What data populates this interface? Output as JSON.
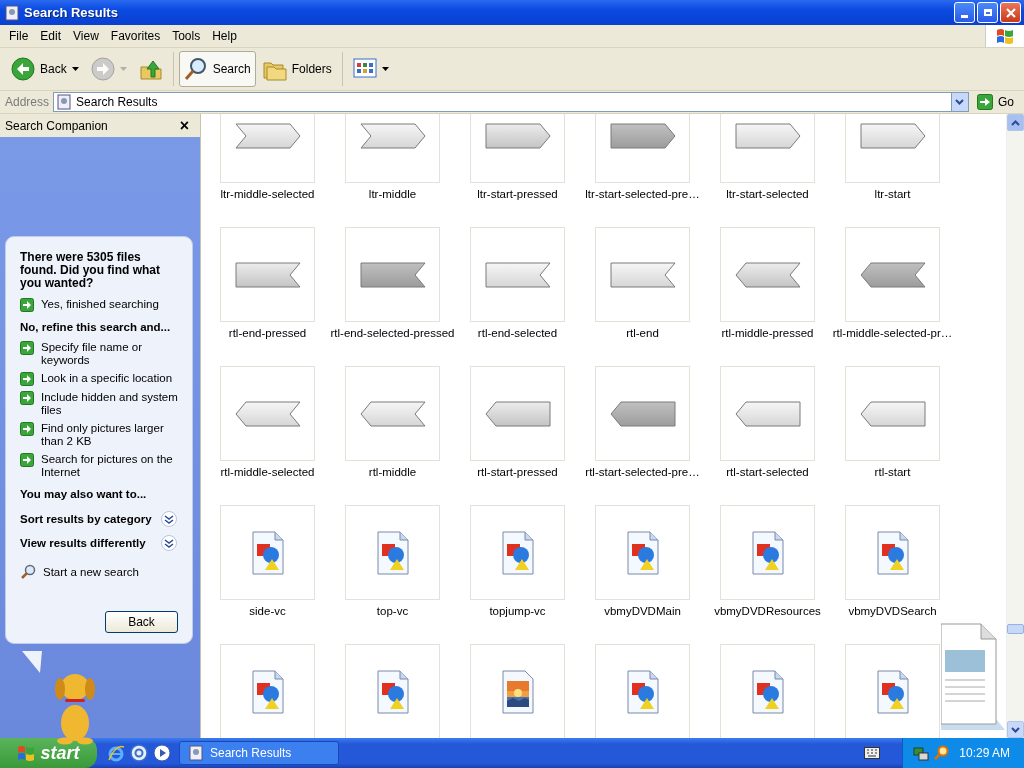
{
  "window": {
    "title": "Search Results"
  },
  "menu": [
    "File",
    "Edit",
    "View",
    "Favorites",
    "Tools",
    "Help"
  ],
  "toolbar": [
    {
      "kind": "back",
      "label": "Back",
      "disabled": false
    },
    {
      "kind": "forward",
      "disabled": true
    },
    {
      "kind": "up"
    },
    {
      "kind": "search",
      "label": "Search",
      "selected": true
    },
    {
      "kind": "folders",
      "label": "Folders",
      "selected": false
    },
    {
      "kind": "views"
    }
  ],
  "address": {
    "label": "Address",
    "value": "Search Results",
    "go": "Go"
  },
  "companion": {
    "title": "Search Companion",
    "close": "×",
    "message": "There were 5305 files found. Did you find what you wanted?",
    "done_links": [
      "Yes, finished searching"
    ],
    "refine_heading": "No, refine this search and...",
    "refine_links": [
      "Specify file name or keywords",
      "Look in a specific location",
      "Include hidden and system files",
      "Find only pictures larger than 2 KB",
      "Search for pictures on the Internet"
    ],
    "also_heading": "You may also want to...",
    "options": [
      {
        "text": "Sort results by category",
        "expanded": false
      },
      {
        "text": "View results differently",
        "expanded": false
      }
    ],
    "new_search": "Start a new search",
    "back_button": "Back"
  },
  "files": [
    {
      "name": "ltr-middle-selected",
      "kind": "ltr_middle"
    },
    {
      "name": "ltr-middle",
      "kind": "ltr_middle"
    },
    {
      "name": "ltr-start-pressed",
      "kind": "ltr_start_pressed"
    },
    {
      "name": "ltr-start-selected-pre…",
      "kind": "ltr_start_dark"
    },
    {
      "name": "ltr-start-selected",
      "kind": "ltr_start"
    },
    {
      "name": "ltr-start",
      "kind": "ltr_start"
    },
    {
      "name": "rtl-end-pressed",
      "kind": "rtl_end_pressed"
    },
    {
      "name": "rtl-end-selected-pressed",
      "kind": "rtl_end_dark"
    },
    {
      "name": "rtl-end-selected",
      "kind": "rtl_end"
    },
    {
      "name": "rtl-end",
      "kind": "rtl_end"
    },
    {
      "name": "rtl-middle-pressed",
      "kind": "rtl_middle_pressed"
    },
    {
      "name": "rtl-middle-selected-pr…",
      "kind": "rtl_middle_dark"
    },
    {
      "name": "rtl-middle-selected",
      "kind": "rtl_middle"
    },
    {
      "name": "rtl-middle",
      "kind": "rtl_middle"
    },
    {
      "name": "rtl-start-pressed",
      "kind": "rtl_start_pressed"
    },
    {
      "name": "rtl-start-selected-pre…",
      "kind": "rtl_start_dark"
    },
    {
      "name": "rtl-start-selected",
      "kind": "rtl_start"
    },
    {
      "name": "rtl-start",
      "kind": "rtl_start"
    },
    {
      "name": "side-vc",
      "kind": "image"
    },
    {
      "name": "top-vc",
      "kind": "image"
    },
    {
      "name": "topjump-vc",
      "kind": "image"
    },
    {
      "name": "vbmyDVDMain",
      "kind": "image"
    },
    {
      "name": "vbmyDVDResources",
      "kind": "image"
    },
    {
      "name": "vbmyDVDSearch",
      "kind": "image"
    },
    {
      "kind": "image"
    },
    {
      "kind": "image"
    },
    {
      "kind": "photo"
    },
    {
      "kind": "image"
    },
    {
      "kind": "image"
    },
    {
      "kind": "image"
    }
  ],
  "taskbar": {
    "start": "start",
    "tasks": [
      "Search Results"
    ],
    "clock": "10:29 AM"
  }
}
